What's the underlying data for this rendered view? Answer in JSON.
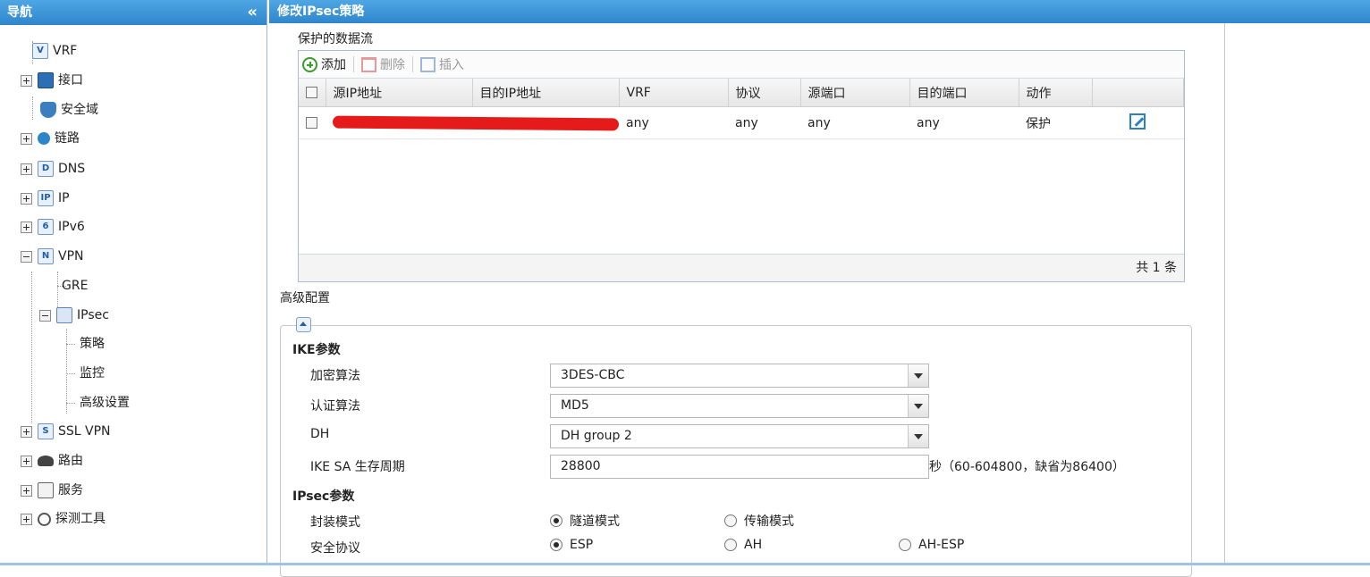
{
  "nav": {
    "title": "导航",
    "collapse_glyph": "«",
    "items": [
      {
        "label": "VRF",
        "icon": "vrf-icon",
        "expand": "none"
      },
      {
        "label": "接口",
        "icon": "interface-icon",
        "expand": "plus"
      },
      {
        "label": "安全域",
        "icon": "security-zone-icon",
        "expand": "none"
      },
      {
        "label": "链路",
        "icon": "link-icon",
        "expand": "plus"
      },
      {
        "label": "DNS",
        "icon": "dns-icon",
        "expand": "plus"
      },
      {
        "label": "IP",
        "icon": "ip-icon",
        "expand": "plus"
      },
      {
        "label": "IPv6",
        "icon": "ipv6-icon",
        "expand": "plus"
      },
      {
        "label": "VPN",
        "icon": "vpn-icon",
        "expand": "minus"
      },
      {
        "label": "GRE",
        "icon": "",
        "expand": "none"
      },
      {
        "label": "IPsec",
        "icon": "ipsec-icon",
        "expand": "minus"
      },
      {
        "label": "策略",
        "icon": "",
        "expand": "none"
      },
      {
        "label": "监控",
        "icon": "",
        "expand": "none"
      },
      {
        "label": "高级设置",
        "icon": "",
        "expand": "none"
      },
      {
        "label": "SSL VPN",
        "icon": "sslvpn-icon",
        "expand": "plus"
      },
      {
        "label": "路由",
        "icon": "route-icon",
        "expand": "plus"
      },
      {
        "label": "服务",
        "icon": "service-icon",
        "expand": "plus"
      },
      {
        "label": "探测工具",
        "icon": "probe-tool-icon",
        "expand": "plus"
      }
    ]
  },
  "main": {
    "title": "修改IPsec策略",
    "protected_flow_label": "保护的数据流",
    "toolbar": {
      "add": "添加",
      "delete": "删除",
      "insert": "插入"
    },
    "columns": [
      "源IP地址",
      "目的IP地址",
      "VRF",
      "协议",
      "源端口",
      "目的端口",
      "动作"
    ],
    "rows": [
      {
        "src_ip": "",
        "dst_ip": "",
        "vrf": "any",
        "protocol": "any",
        "src_port": "any",
        "dst_port": "any",
        "action": "保护"
      }
    ],
    "footer": "共 1 条",
    "advanced_label": "高级配置",
    "ike": {
      "title": "IKE参数",
      "encryption_label": "加密算法",
      "encryption_value": "3DES-CBC",
      "auth_label": "认证算法",
      "auth_value": "MD5",
      "dh_label": "DH",
      "dh_value": "DH group 2",
      "lifetime_label": "IKE SA 生存周期",
      "lifetime_value": "28800",
      "lifetime_hint": "秒（60-604800，缺省为86400）"
    },
    "ipsec": {
      "title": "IPsec参数",
      "encap_label": "封装模式",
      "encap_options": [
        "隧道模式",
        "传输模式"
      ],
      "encap_selected": "隧道模式",
      "protocol_label": "安全协议",
      "protocol_options": [
        "ESP",
        "AH",
        "AH-ESP"
      ],
      "protocol_selected": "ESP"
    }
  }
}
